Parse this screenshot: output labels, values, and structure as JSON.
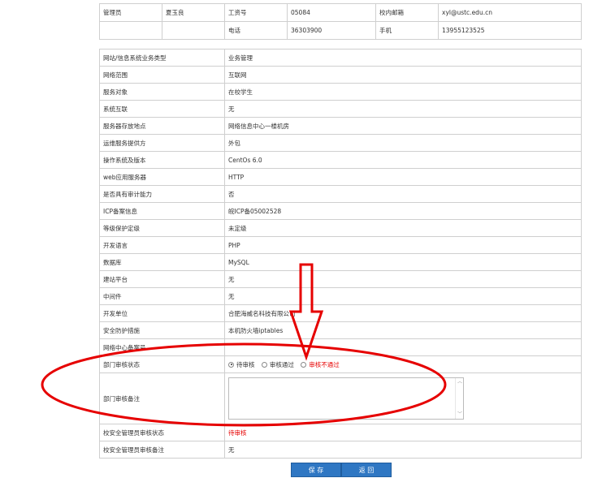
{
  "contact": {
    "row1": [
      "管理员",
      "夏玉良",
      "工资号",
      "05084",
      "校内邮箱",
      "xyl@ustc.edu.cn"
    ],
    "row2": [
      "",
      "",
      "电话",
      "36303900",
      "手机",
      "13955123525"
    ]
  },
  "info_rows": [
    {
      "label": "网站/信息系统业务类型",
      "value": "业务管理"
    },
    {
      "label": "网络范围",
      "value": "互联网"
    },
    {
      "label": "服务对象",
      "value": "在校学生"
    },
    {
      "label": "系统互联",
      "value": "无"
    },
    {
      "label": "服务器存放地点",
      "value": "网络信息中心一楼机房"
    },
    {
      "label": "运维服务提供方",
      "value": "外包"
    },
    {
      "label": "操作系统及版本",
      "value": "CentOs 6.0"
    },
    {
      "label": "web应用服务器",
      "value": "HTTP"
    },
    {
      "label": "是否具有审计能力",
      "value": "否"
    },
    {
      "label": "ICP备案信息",
      "value": "皖ICP备05002528"
    },
    {
      "label": "等级保护定级",
      "value": "未定级"
    },
    {
      "label": "开发语言",
      "value": "PHP"
    },
    {
      "label": "数据库",
      "value": "MySQL"
    },
    {
      "label": "建站平台",
      "value": "无"
    },
    {
      "label": "中间件",
      "value": "无"
    },
    {
      "label": "开发单位",
      "value": "合肥海威名科技有限公司"
    },
    {
      "label": "安全防护措施",
      "value": "本机防火墙iptables"
    },
    {
      "label": "网络中心备案号",
      "value": ""
    }
  ],
  "dept_review": {
    "label": "部门审核状态",
    "options": [
      "待审核",
      "审核通过",
      "审核不通过"
    ],
    "selected_index": 0
  },
  "dept_note": {
    "label": "部门审核备注",
    "value": ""
  },
  "school_status": {
    "label": "校安全管理员审核状态",
    "value": "待审核"
  },
  "school_note": {
    "label": "校安全管理员审核备注",
    "value": "无"
  },
  "buttons": {
    "save": "保 存",
    "back": "返 回"
  },
  "colors": {
    "annotation": "#e60000",
    "button": "#2f77c3",
    "pending": "#e60000"
  }
}
